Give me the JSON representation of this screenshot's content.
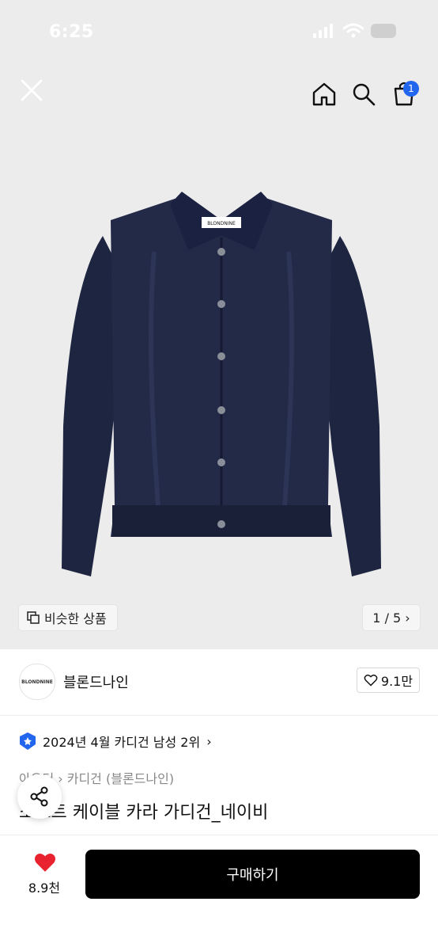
{
  "status_bar": {
    "time": "6:25"
  },
  "header": {
    "close_icon": "close-icon",
    "home_icon": "home-icon",
    "search_icon": "search-icon",
    "cart_icon": "cart-icon",
    "cart_count": "1",
    "accent_color": "#2266ee"
  },
  "gallery": {
    "product_label_text": "BLONDNINE",
    "similar_label": "비슷한 상품",
    "pager": "1 / 5 ›"
  },
  "brand": {
    "logo_text": "BLONDNINE",
    "name": "블론드나인",
    "likes": "9.1만"
  },
  "product": {
    "rank": "2024년 4월 카디건 남성 2위",
    "breadcrumb": "아우터 › 카디건 (블론드나인)",
    "title": "소프트 케이블 카라 가디건_네이비"
  },
  "footer": {
    "heart_count": "8.9천",
    "buy_label": "구매하기",
    "heart_color": "#e8222f"
  }
}
